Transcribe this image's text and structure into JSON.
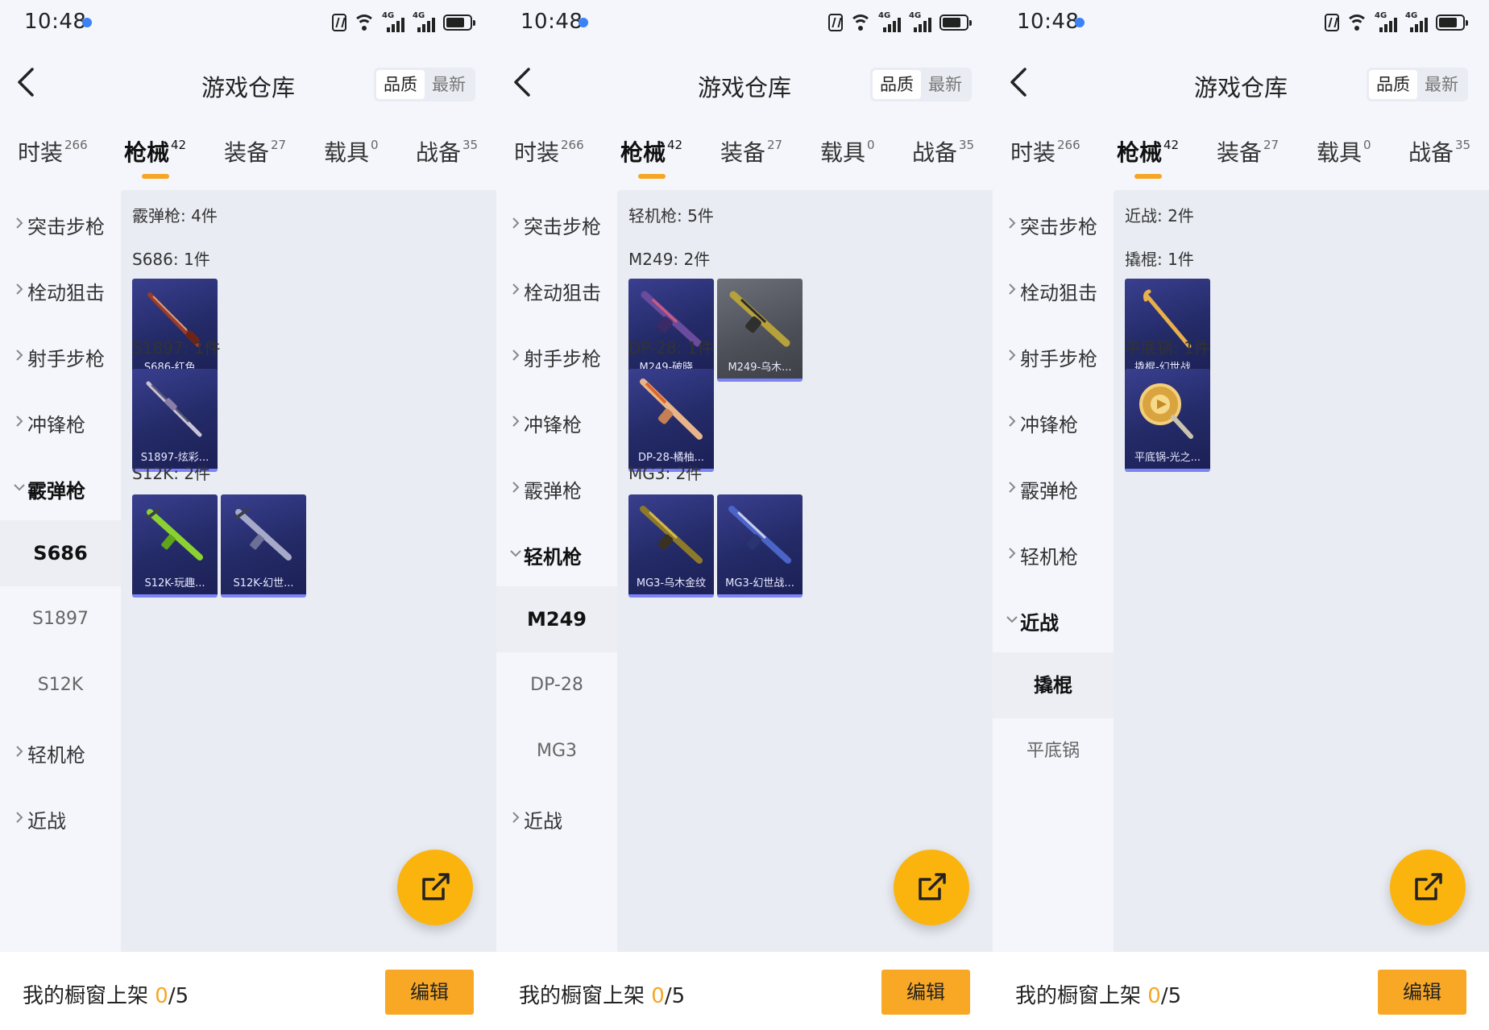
{
  "colors": {
    "accent": "#f6a623",
    "fab": "#fbb40e",
    "status_dot": "#3b82f6",
    "card_bg": "#232a66",
    "card_border": "#7c83f5"
  },
  "panels": [
    {
      "status": {
        "time": "10:48"
      },
      "header": {
        "title": "游戏仓库",
        "sort_quality": "品质",
        "sort_latest": "最新"
      },
      "tabs": [
        {
          "label": "时装",
          "count": "266"
        },
        {
          "label": "枪械",
          "count": "42"
        },
        {
          "label": "装备",
          "count": "27"
        },
        {
          "label": "载具",
          "count": "0"
        },
        {
          "label": "战备",
          "count": "35"
        }
      ],
      "categories": [
        {
          "label": "突击步枪"
        },
        {
          "label": "栓动狙击"
        },
        {
          "label": "射手步枪"
        },
        {
          "label": "冲锋枪"
        },
        {
          "label": "霰弹枪"
        },
        {
          "label": "轻机枪"
        },
        {
          "label": "近战"
        }
      ],
      "subitems": [
        {
          "label": "S686"
        },
        {
          "label": "S1897"
        },
        {
          "label": "S12K"
        }
      ],
      "section_title": "霰弹枪: 4件",
      "groups": [
        {
          "title": "S686: 1件",
          "items": [
            {
              "name": "S686-红色...",
              "icon": "shotgun-icon"
            }
          ]
        },
        {
          "title": "S1897: 1件",
          "items": [
            {
              "name": "S1897-炫彩...",
              "icon": "shotgun-icon"
            }
          ]
        },
        {
          "title": "S12K: 2件",
          "items": [
            {
              "name": "S12K-玩趣...",
              "icon": "rifle-icon"
            },
            {
              "name": "S12K-幻世...",
              "icon": "rifle-icon"
            }
          ]
        }
      ],
      "footer": {
        "label": "我的橱窗上架 ",
        "count": "0",
        "total": "/5",
        "edit": "编辑"
      }
    },
    {
      "status": {
        "time": "10:48"
      },
      "header": {
        "title": "游戏仓库",
        "sort_quality": "品质",
        "sort_latest": "最新"
      },
      "tabs": [
        {
          "label": "时装",
          "count": "266"
        },
        {
          "label": "枪械",
          "count": "42"
        },
        {
          "label": "装备",
          "count": "27"
        },
        {
          "label": "载具",
          "count": "0"
        },
        {
          "label": "战备",
          "count": "35"
        }
      ],
      "categories": [
        {
          "label": "突击步枪"
        },
        {
          "label": "栓动狙击"
        },
        {
          "label": "射手步枪"
        },
        {
          "label": "冲锋枪"
        },
        {
          "label": "霰弹枪"
        },
        {
          "label": "轻机枪"
        },
        {
          "label": "近战"
        }
      ],
      "subitems": [
        {
          "label": "M249"
        },
        {
          "label": "DP-28"
        },
        {
          "label": "MG3"
        }
      ],
      "section_title": "轻机枪: 5件",
      "groups": [
        {
          "title": "M249: 2件",
          "items": [
            {
              "name": "M249-破晓...",
              "icon": "lmg-icon"
            },
            {
              "name": "M249-乌木...",
              "icon": "lmg-icon"
            }
          ]
        },
        {
          "title": "DP-28: 1件",
          "items": [
            {
              "name": "DP-28-橘柚...",
              "icon": "lmg-icon"
            }
          ]
        },
        {
          "title": "MG3: 2件",
          "items": [
            {
              "name": "MG3-乌木金纹",
              "icon": "lmg-icon"
            },
            {
              "name": "MG3-幻世战...",
              "icon": "lmg-icon"
            }
          ]
        }
      ],
      "footer": {
        "label": "我的橱窗上架 ",
        "count": "0",
        "total": "/5",
        "edit": "编辑"
      }
    },
    {
      "status": {
        "time": "10:48"
      },
      "header": {
        "title": "游戏仓库",
        "sort_quality": "品质",
        "sort_latest": "最新"
      },
      "tabs": [
        {
          "label": "时装",
          "count": "266"
        },
        {
          "label": "枪械",
          "count": "42"
        },
        {
          "label": "装备",
          "count": "27"
        },
        {
          "label": "载具",
          "count": "0"
        },
        {
          "label": "战备",
          "count": "35"
        }
      ],
      "categories": [
        {
          "label": "突击步枪"
        },
        {
          "label": "栓动狙击"
        },
        {
          "label": "射手步枪"
        },
        {
          "label": "冲锋枪"
        },
        {
          "label": "霰弹枪"
        },
        {
          "label": "轻机枪"
        },
        {
          "label": "近战"
        }
      ],
      "subitems": [
        {
          "label": "撬棍"
        },
        {
          "label": "平底锅"
        }
      ],
      "section_title": "近战: 2件",
      "groups": [
        {
          "title": "撬棍: 1件",
          "items": [
            {
              "name": "撬棍-幻世战...",
              "icon": "crowbar-icon"
            }
          ]
        },
        {
          "title": "平底锅: 1件",
          "items": [
            {
              "name": "平底锅-光之...",
              "icon": "frying-pan-icon"
            }
          ]
        }
      ],
      "footer": {
        "label": "我的橱窗上架 ",
        "count": "0",
        "total": "/5",
        "edit": "编辑"
      }
    }
  ]
}
